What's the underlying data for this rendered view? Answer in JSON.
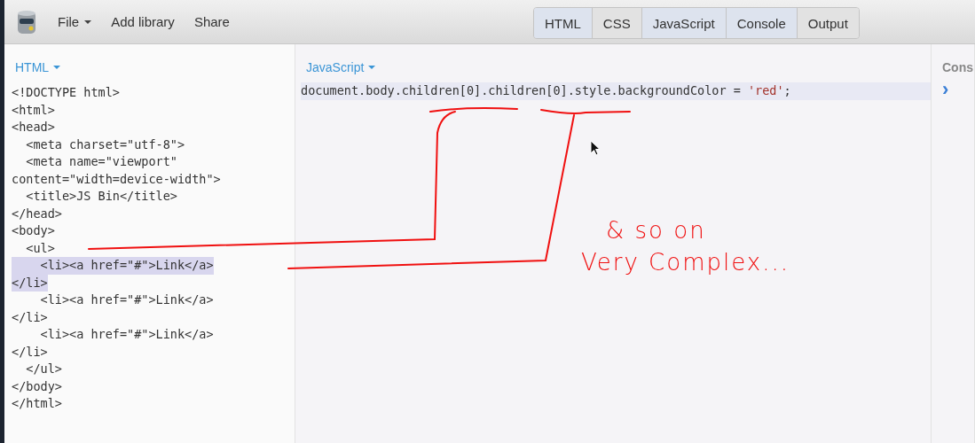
{
  "toolbar": {
    "menus": [
      {
        "label": "File",
        "dropdown": true
      },
      {
        "label": "Add library",
        "dropdown": false
      },
      {
        "label": "Share",
        "dropdown": false
      }
    ],
    "tabs": [
      {
        "label": "HTML",
        "selected": true
      },
      {
        "label": "CSS",
        "selected": false
      },
      {
        "label": "JavaScript",
        "selected": true
      },
      {
        "label": "Console",
        "selected": true
      },
      {
        "label": "Output",
        "selected": false
      }
    ]
  },
  "html_panel": {
    "title": "HTML",
    "lines": [
      {
        "text": "<!DOCTYPE html>",
        "selected": false
      },
      {
        "text": "<html>",
        "selected": false
      },
      {
        "text": "<head>",
        "selected": false
      },
      {
        "text": "  <meta charset=\"utf-8\">",
        "selected": false
      },
      {
        "text": "  <meta name=\"viewport\"",
        "selected": false
      },
      {
        "text": "content=\"width=device-width\">",
        "selected": false
      },
      {
        "text": "  <title>JS Bin</title>",
        "selected": false
      },
      {
        "text": "</head>",
        "selected": false
      },
      {
        "text": "<body>",
        "selected": false
      },
      {
        "text": "  <ul>",
        "selected": false
      },
      {
        "text": "    <li><a href=\"#\">Link</a>",
        "selected": true
      },
      {
        "text": "</li>",
        "selected": true
      },
      {
        "text": "    <li><a href=\"#\">Link</a>",
        "selected": false
      },
      {
        "text": "</li>",
        "selected": false
      },
      {
        "text": "    <li><a href=\"#\">Link</a>",
        "selected": false
      },
      {
        "text": "</li>",
        "selected": false
      },
      {
        "text": "  </ul>",
        "selected": false
      },
      {
        "text": "</body>",
        "selected": false
      },
      {
        "text": "</html>",
        "selected": false
      }
    ]
  },
  "js_panel": {
    "title": "JavaScript",
    "lines": [
      {
        "tokens": [
          {
            "text": "document.body.children[0].children[0].style.backgroundColor = ",
            "kind": "plain"
          },
          {
            "text": "'red'",
            "kind": "string"
          },
          {
            "text": ";",
            "kind": "plain"
          }
        ],
        "selected": true
      }
    ]
  },
  "console_panel": {
    "title": "Cons",
    "prompt": "›"
  },
  "annotation": {
    "lines": [
      "& so on",
      "Very Complex..."
    ]
  }
}
